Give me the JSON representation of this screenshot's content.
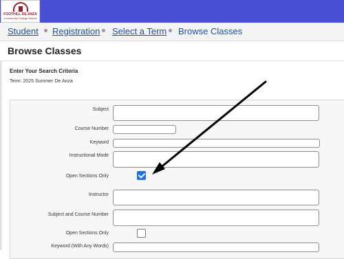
{
  "header": {
    "logo_name": "FOOTHILL·DE ANZA",
    "logo_sub": "Community College District",
    "colors": {
      "topbar": "#4b4fd4",
      "link": "#1d4fa3"
    }
  },
  "breadcrumb": [
    "Student",
    "Registration",
    "Select a Term",
    "Browse Classes"
  ],
  "page_title": "Browse Classes",
  "search": {
    "heading": "Enter Your Search Criteria",
    "term_text": "Term: 2025 Summer De Anza"
  },
  "fields": {
    "subject": "Subject",
    "course_number": "Course Number",
    "keyword": "Keyword",
    "instructional_mode": "Instructional Mode",
    "open_sections_1": "Open Sections Only",
    "instructor": "Instructor",
    "subject_course_number": "Subject and Course Number",
    "open_sections_2": "Open Sections Only",
    "keyword_any": "Keyword (With Any Words)"
  },
  "checkbox_states": {
    "open_sections_1": true,
    "open_sections_2": false
  }
}
